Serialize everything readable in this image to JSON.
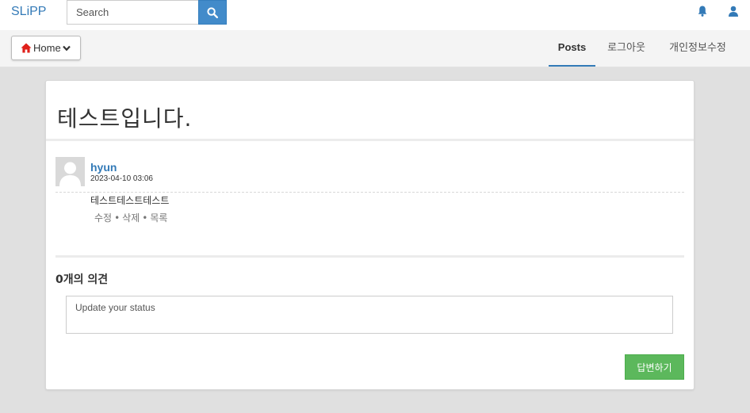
{
  "topbar": {
    "brand": "SLiPP",
    "search": {
      "placeholder": "Search",
      "value": ""
    }
  },
  "subnav": {
    "home_label": "Home",
    "tabs": [
      {
        "label": "Posts",
        "active": true
      },
      {
        "label": "로그아웃",
        "active": false
      },
      {
        "label": "개인정보수정",
        "active": false
      }
    ]
  },
  "post": {
    "title": "테스트입니다.",
    "author": "hyun",
    "date": "2023-04-10 03:06",
    "body": "테스트테스트테스트",
    "actions": {
      "edit": "수정",
      "delete": "삭제",
      "list": "목록",
      "separator": "•"
    }
  },
  "comments": {
    "heading": "0개의 의견",
    "input": {
      "placeholder": "Update your status",
      "value": ""
    },
    "submit_label": "답변하기"
  },
  "colors": {
    "brand": "#337ab7",
    "search_button": "#428bca",
    "home_icon": "#e0201a",
    "reply_button": "#5cb85c",
    "page_background": "#e0e0e0"
  },
  "icons": {
    "search": "search-icon",
    "bell": "bell-icon",
    "user": "user-icon",
    "home": "home-icon",
    "caret": "chevron-down-icon",
    "avatar": "user-avatar-placeholder"
  }
}
